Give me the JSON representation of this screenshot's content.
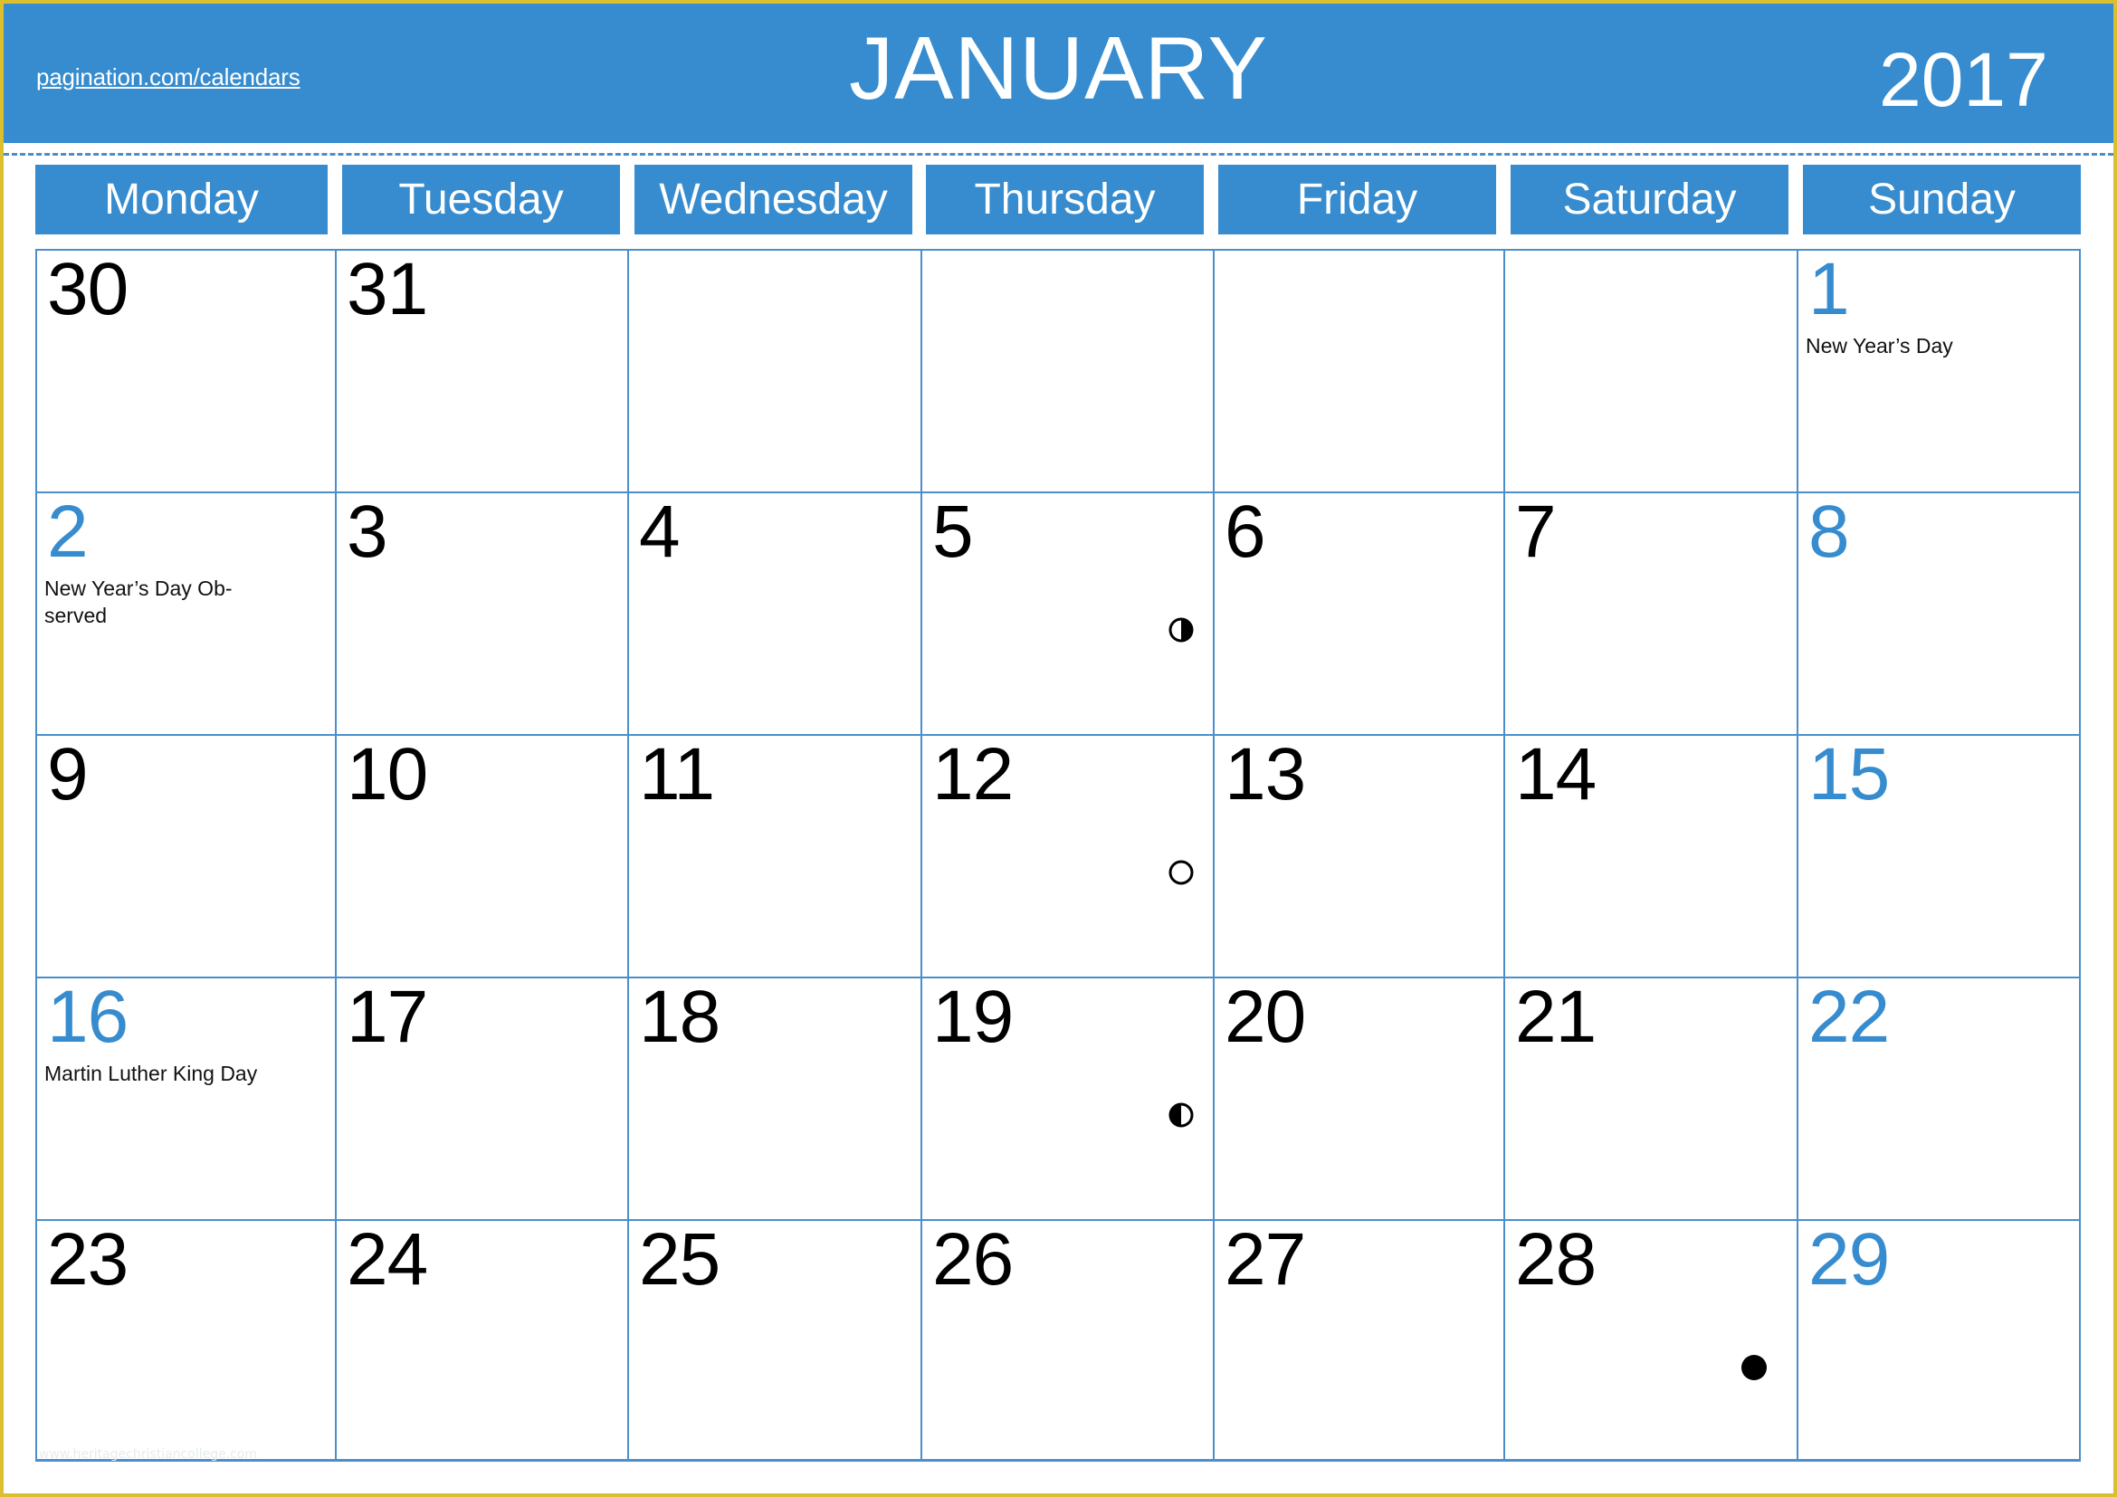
{
  "header": {
    "site_link": "pagination.com/calendars",
    "month": "JANUARY",
    "year": "2017"
  },
  "colors": {
    "accent_blue": "#368cce",
    "frame_yellow": "#dcbf2e",
    "grid_line": "#4a8fcb",
    "text": "#000000"
  },
  "weekdays": [
    "Monday",
    "Tuesday",
    "Wednesday",
    "Thursday",
    "Friday",
    "Saturday",
    "Sunday"
  ],
  "weeks": [
    [
      {
        "day": "30",
        "outside": true
      },
      {
        "day": "31",
        "outside": true
      },
      {
        "day": ""
      },
      {
        "day": ""
      },
      {
        "day": ""
      },
      {
        "day": ""
      },
      {
        "day": "1",
        "sunday": true,
        "holiday": "New Year’s Day"
      }
    ],
    [
      {
        "day": "2",
        "holiday": "New Year’s Day Ob-\nserved",
        "highlight": true
      },
      {
        "day": "3"
      },
      {
        "day": "4"
      },
      {
        "day": "5",
        "moon": "first-quarter"
      },
      {
        "day": "6"
      },
      {
        "day": "7"
      },
      {
        "day": "8",
        "sunday": true
      }
    ],
    [
      {
        "day": "9"
      },
      {
        "day": "10"
      },
      {
        "day": "11"
      },
      {
        "day": "12",
        "moon": "full"
      },
      {
        "day": "13"
      },
      {
        "day": "14"
      },
      {
        "day": "15",
        "sunday": true
      }
    ],
    [
      {
        "day": "16",
        "holiday": "Martin Luther King Day",
        "highlight": true
      },
      {
        "day": "17"
      },
      {
        "day": "18"
      },
      {
        "day": "19",
        "moon": "last-quarter"
      },
      {
        "day": "20"
      },
      {
        "day": "21"
      },
      {
        "day": "22",
        "sunday": true
      }
    ],
    [
      {
        "day": "23"
      },
      {
        "day": "24"
      },
      {
        "day": "25"
      },
      {
        "day": "26"
      },
      {
        "day": "27"
      },
      {
        "day": "28",
        "moon": "new"
      },
      {
        "day": "29",
        "sunday": true
      }
    ]
  ],
  "moon_phase_icons": {
    "first-quarter": "first-quarter-moon-icon",
    "full": "full-moon-icon",
    "last-quarter": "last-quarter-moon-icon",
    "new": "new-moon-icon"
  },
  "watermark": "www.heritagechristiancollege.com"
}
